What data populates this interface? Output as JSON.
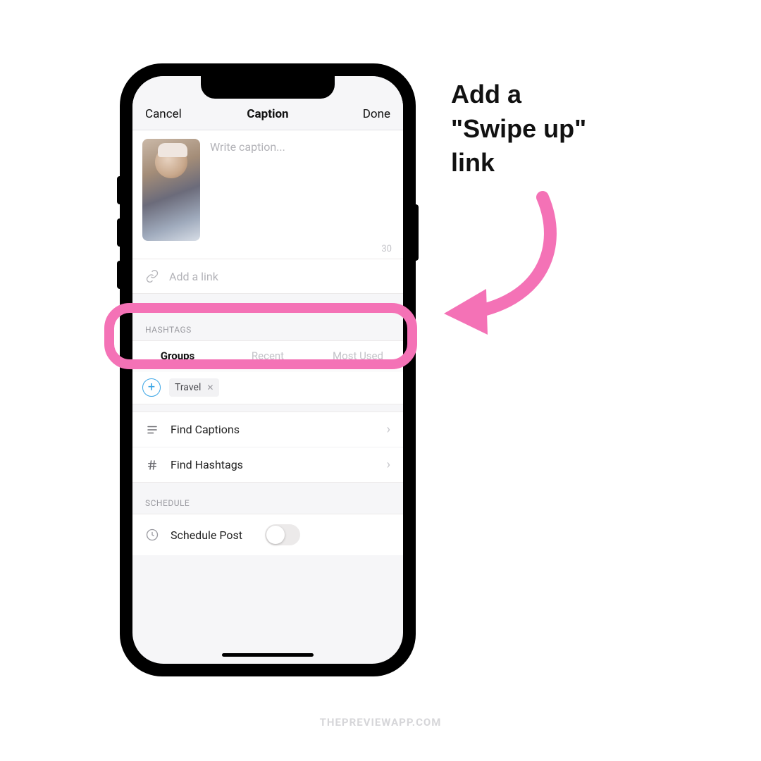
{
  "annotation": {
    "line1": "Add a",
    "line2": "\"Swipe up\"",
    "line3": "link"
  },
  "navbar": {
    "cancel": "Cancel",
    "title": "Caption",
    "done": "Done"
  },
  "caption": {
    "placeholder": "Write caption...",
    "counter": "30"
  },
  "link": {
    "placeholder": "Add a link"
  },
  "hashtags": {
    "header": "HASHTAGS",
    "tabs": {
      "groups": "Groups",
      "recent": "Recent",
      "most_used": "Most Used"
    },
    "chip": "Travel"
  },
  "rows": {
    "find_captions": "Find Captions",
    "find_hashtags": "Find Hashtags"
  },
  "schedule": {
    "header": "SCHEDULE",
    "label": "Schedule Post"
  },
  "watermark": "THEPREVIEWAPP.COM",
  "colors": {
    "accent_pink": "#f472b6",
    "accent_blue": "#3ca6e6"
  }
}
